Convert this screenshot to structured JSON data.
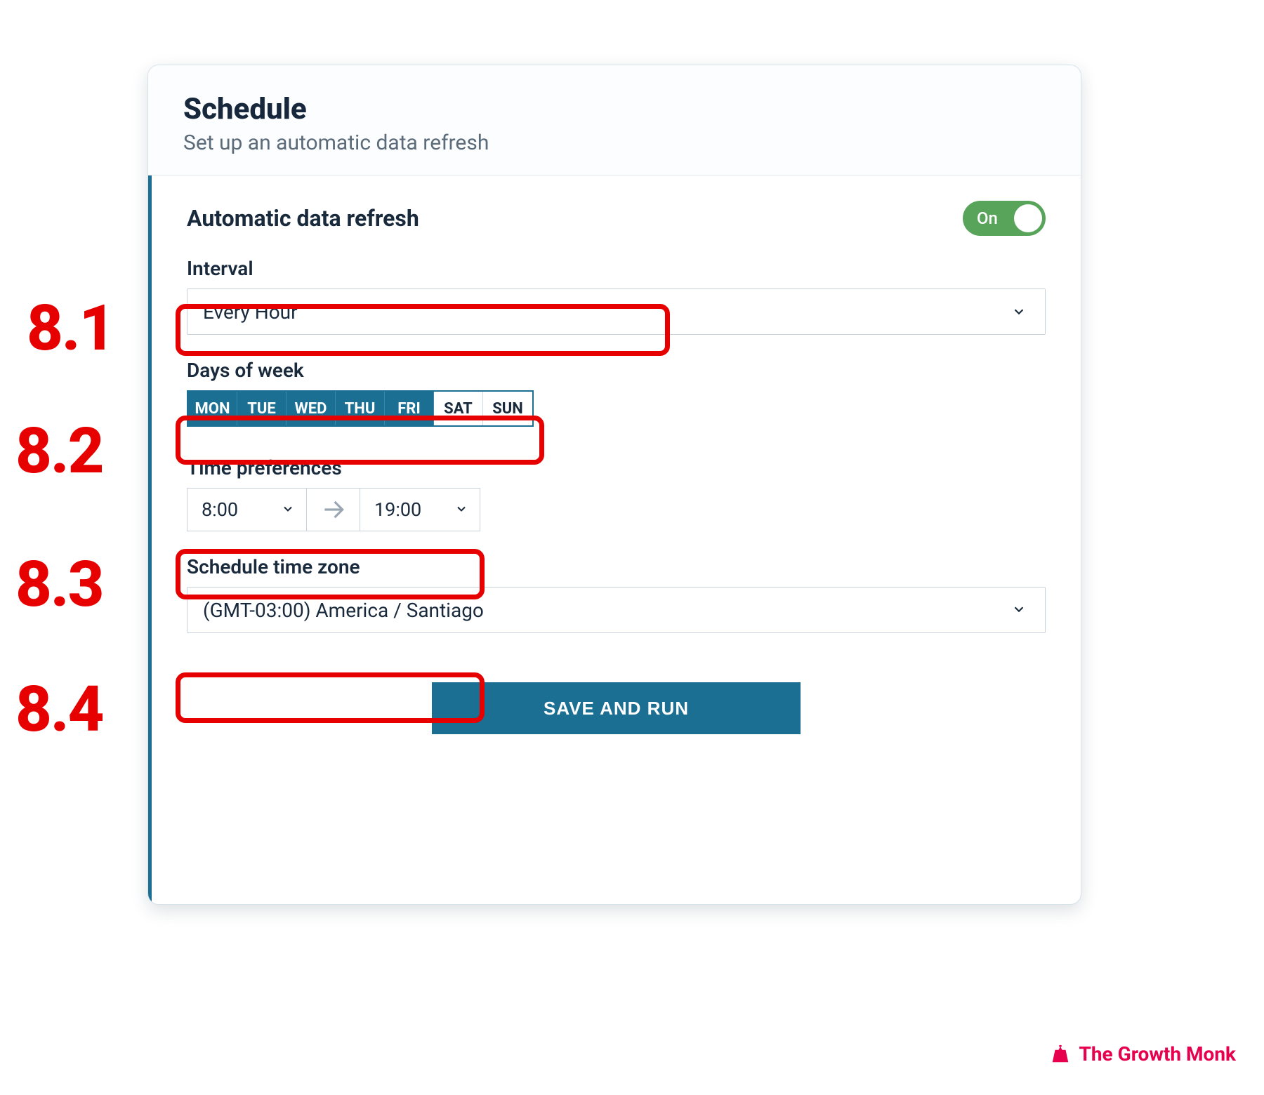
{
  "annotations": {
    "a1": "8.1",
    "a2": "8.2",
    "a3": "8.3",
    "a4": "8.4"
  },
  "card": {
    "title": "Schedule",
    "subtitle": "Set up an automatic data refresh"
  },
  "toggle": {
    "section_label": "Automatic data refresh",
    "state_label": "On",
    "on": true
  },
  "interval": {
    "label": "Interval",
    "value": "Every Hour"
  },
  "days": {
    "label": "Days of week",
    "items": [
      {
        "abbr": "MON",
        "selected": true
      },
      {
        "abbr": "TUE",
        "selected": true
      },
      {
        "abbr": "WED",
        "selected": true
      },
      {
        "abbr": "THU",
        "selected": true
      },
      {
        "abbr": "FRI",
        "selected": true
      },
      {
        "abbr": "SAT",
        "selected": false
      },
      {
        "abbr": "SUN",
        "selected": false
      }
    ]
  },
  "time_pref": {
    "label": "Time preferences",
    "from": "8:00",
    "to": "19:00"
  },
  "timezone": {
    "label": "Schedule time zone",
    "value": "(GMT-03:00) America / Santiago"
  },
  "buttons": {
    "save": "SAVE AND RUN"
  },
  "brand": {
    "name": "The Growth Monk"
  },
  "colors": {
    "accent": "#1b6f93",
    "annotation": "#e60000",
    "toggle_on": "#58a45b",
    "brand": "#e6004d"
  }
}
